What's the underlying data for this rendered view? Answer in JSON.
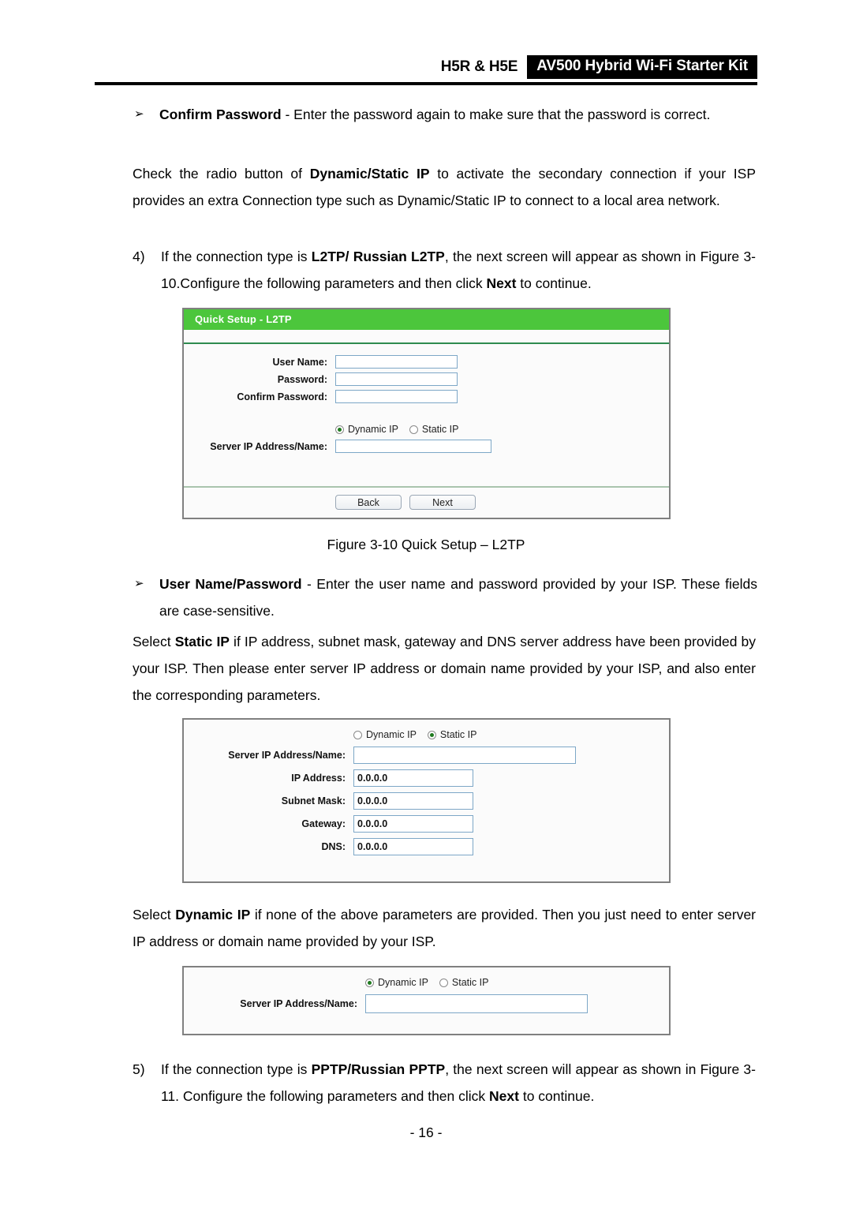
{
  "header": {
    "model": "H5R & H5E",
    "product": "AV500 Hybrid Wi-Fi Starter Kit"
  },
  "bullet_confirm": {
    "marker": "➢",
    "bold": "Confirm Password",
    "rest": " - Enter the password again to make sure that the password is correct."
  },
  "para_check": {
    "part1": "Check the radio button of ",
    "bold1": "Dynamic/Static IP",
    "part2": " to activate the secondary connection if your ISP provides an extra Connection type such as Dynamic/Static IP to connect to a local area network."
  },
  "item4": {
    "marker": "4)",
    "part1": "If the connection type is ",
    "bold1": "L2TP/ Russian L2TP",
    "part2": ", the next screen will appear as shown in Figure 3-10.Configure the following parameters and then click ",
    "bold2": "Next",
    "part3": " to continue."
  },
  "panel_l2tp": {
    "title": "Quick Setup - L2TP",
    "fields": [
      {
        "label": "User Name:",
        "value": ""
      },
      {
        "label": "Password:",
        "value": ""
      },
      {
        "label": "Confirm Password:",
        "value": ""
      }
    ],
    "radios": [
      {
        "label": "Dynamic IP",
        "selected": true
      },
      {
        "label": "Static IP",
        "selected": false
      }
    ],
    "server_label": "Server IP Address/Name:",
    "server_value": "",
    "back_button": "Back",
    "next_button": "Next"
  },
  "caption_310": "Figure 3-10 Quick Setup – L2TP",
  "bullet_username": {
    "marker": "➢",
    "bold": "User Name/Password",
    "rest": " - Enter the user name and password provided by your ISP. These fields are case-sensitive."
  },
  "para_static": {
    "part1": "Select ",
    "bold1": "Static IP",
    "part2": " if IP address, subnet mask, gateway and DNS server address have been provided by your ISP. Then please enter server IP address or domain name provided by your ISP, and also enter the corresponding parameters."
  },
  "panel_static": {
    "radios": [
      {
        "label": "Dynamic IP",
        "selected": false
      },
      {
        "label": "Static IP",
        "selected": true
      }
    ],
    "fields": [
      {
        "label": "Server IP Address/Name:",
        "value": ""
      },
      {
        "label": "IP Address:",
        "value": "0.0.0.0"
      },
      {
        "label": "Subnet Mask:",
        "value": "0.0.0.0"
      },
      {
        "label": "Gateway:",
        "value": "0.0.0.0"
      },
      {
        "label": "DNS:",
        "value": "0.0.0.0"
      }
    ]
  },
  "para_dynamic": {
    "part1": "Select ",
    "bold1": "Dynamic IP",
    "part2": " if none of the above parameters are provided. Then you just need to enter server IP address or domain name provided by your ISP."
  },
  "panel_dynamic": {
    "radios": [
      {
        "label": "Dynamic IP",
        "selected": true
      },
      {
        "label": "Static IP",
        "selected": false
      }
    ],
    "server_label": "Server IP Address/Name:",
    "server_value": ""
  },
  "item5": {
    "marker": "5)",
    "part1": "If the connection type is ",
    "bold1": "PPTP/Russian PPTP",
    "part2": ", the next screen will appear as shown in Figure 3-11. Configure the following parameters and then click ",
    "bold2": "Next",
    "part3": " to continue."
  },
  "page_number": "- 16 -",
  "colors": {
    "panel_title_green": "#4CC63C",
    "rule_green": "#2e8b4f",
    "field_border": "#7da7c7",
    "radio_selected": "#1f7a1f"
  }
}
